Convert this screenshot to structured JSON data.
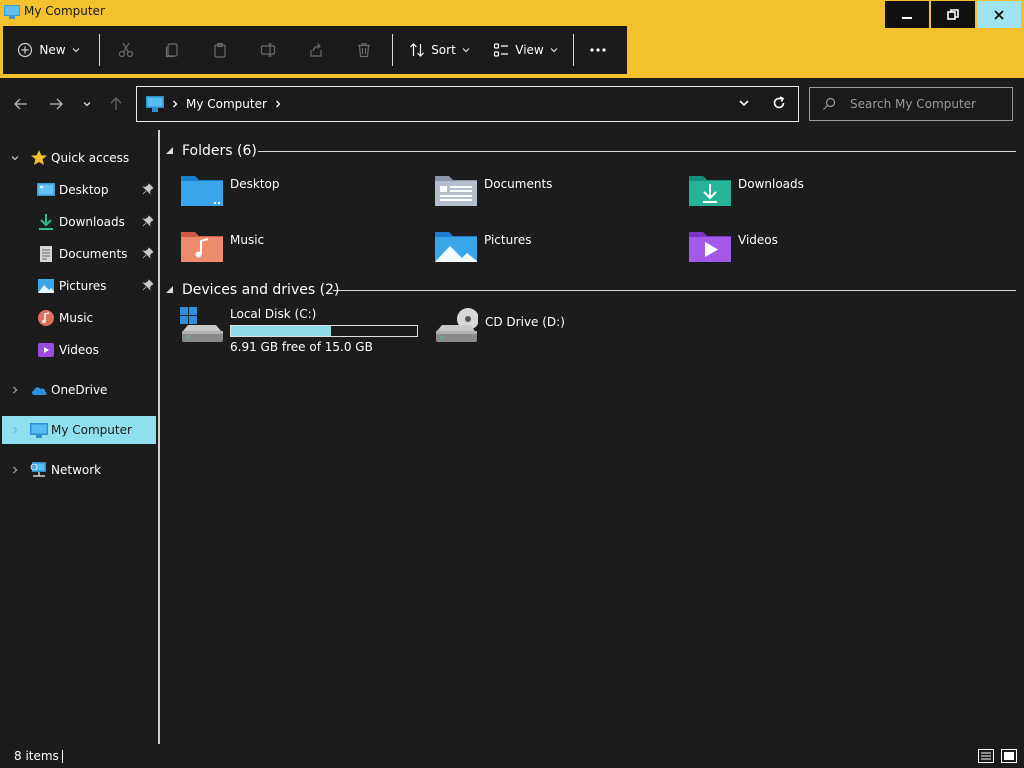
{
  "window": {
    "title": "My Computer",
    "accent_color": "#f4c12e",
    "close_hover_color": "#9ee3ef"
  },
  "toolbar": {
    "new_label": "New",
    "sort_label": "Sort",
    "view_label": "View"
  },
  "address": {
    "path": "My Computer",
    "search_placeholder": "Search My Computer"
  },
  "sidebar": {
    "quick_access": "Quick access",
    "items": [
      {
        "label": "Desktop",
        "icon": "desktop-icon",
        "pinned": true
      },
      {
        "label": "Downloads",
        "icon": "downloads-icon",
        "pinned": true
      },
      {
        "label": "Documents",
        "icon": "documents-icon",
        "pinned": true
      },
      {
        "label": "Pictures",
        "icon": "pictures-icon",
        "pinned": true
      },
      {
        "label": "Music",
        "icon": "music-icon",
        "pinned": false
      },
      {
        "label": "Videos",
        "icon": "videos-icon",
        "pinned": false
      }
    ],
    "onedrive": "OneDrive",
    "my_computer": "My Computer",
    "network": "Network",
    "selected_color": "#8fe0ee"
  },
  "main": {
    "folders_header": "Folders (6)",
    "folders": [
      {
        "name": "Desktop",
        "icon": "desktop-folder-icon"
      },
      {
        "name": "Documents",
        "icon": "documents-folder-icon"
      },
      {
        "name": "Downloads",
        "icon": "downloads-folder-icon"
      },
      {
        "name": "Music",
        "icon": "music-folder-icon"
      },
      {
        "name": "Pictures",
        "icon": "pictures-folder-icon"
      },
      {
        "name": "Videos",
        "icon": "videos-folder-icon"
      }
    ],
    "drives_header": "Devices and drives (2)",
    "drives": [
      {
        "name": "Local Disk (C:)",
        "free_text": "6.91 GB free of 15.0 GB",
        "used_fraction": 0.54,
        "icon": "hard-drive-icon"
      },
      {
        "name": "CD Drive (D:)",
        "icon": "cd-drive-icon"
      }
    ]
  },
  "status": {
    "item_count": "8 items"
  }
}
